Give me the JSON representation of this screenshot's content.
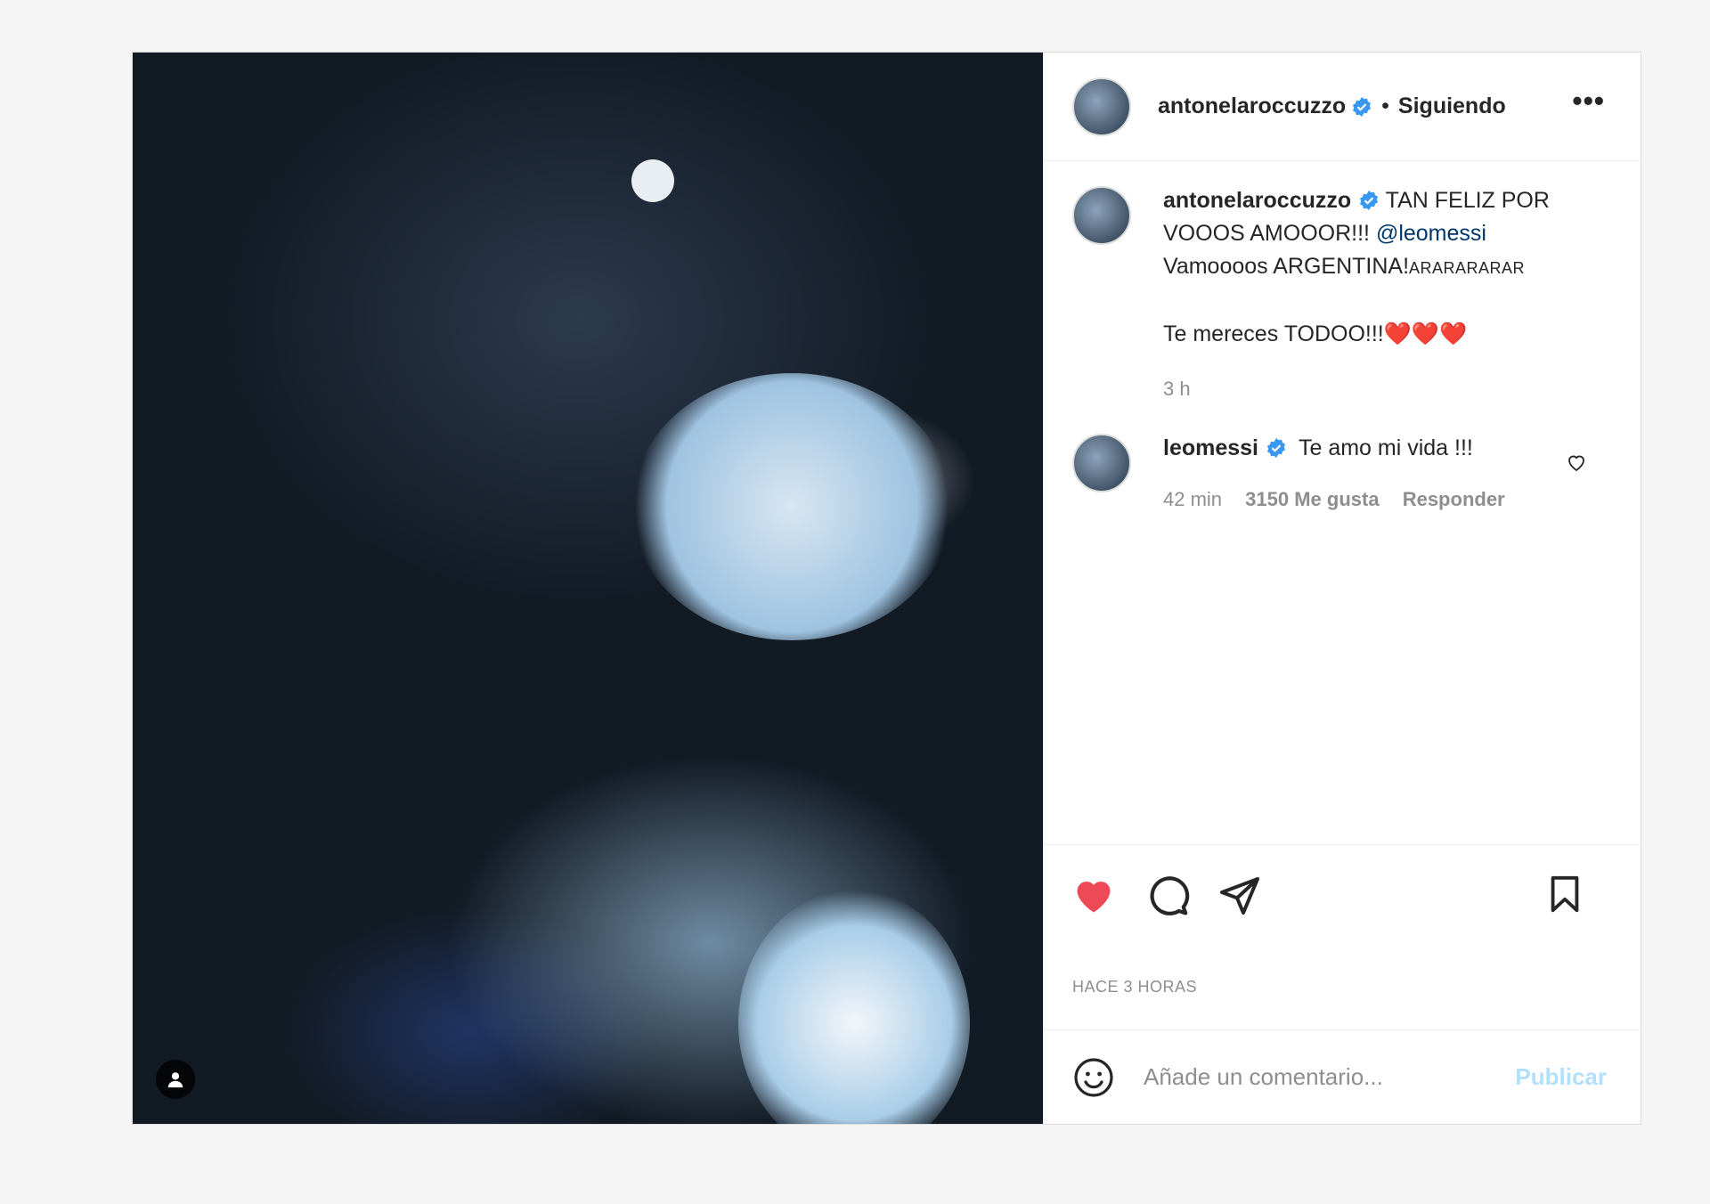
{
  "colors": {
    "accent": "#0095f6",
    "publish_disabled": "#b2dffc",
    "heart_red": "#ed4956",
    "verified": "#3897f0"
  },
  "header": {
    "username": "antonelaroccuzzo",
    "separator": "•",
    "follow_status": "Siguiendo",
    "more_icon": "more-options-icon"
  },
  "caption": {
    "username": "antonelaroccuzzo",
    "text_line1": "TAN FELIZ POR VOOOS AMOOOR!!!",
    "mention": "@leomessi",
    "text_line2": "Vamoooos ARGENTINA!",
    "text_tail": "ARARARARAR",
    "text_line3": "Te mereces TODOO!!!",
    "hearts": "❤️❤️❤️",
    "time": "3 h"
  },
  "reply": {
    "username": "leomessi",
    "text": "Te amo mi vida !!!",
    "time": "42 min",
    "likes": "3150 Me gusta",
    "reply_label": "Responder"
  },
  "post": {
    "timestamp": "HACE 3 HORAS"
  },
  "comment_box": {
    "placeholder": "Añade un comentario...",
    "publish_label": "Publicar"
  }
}
